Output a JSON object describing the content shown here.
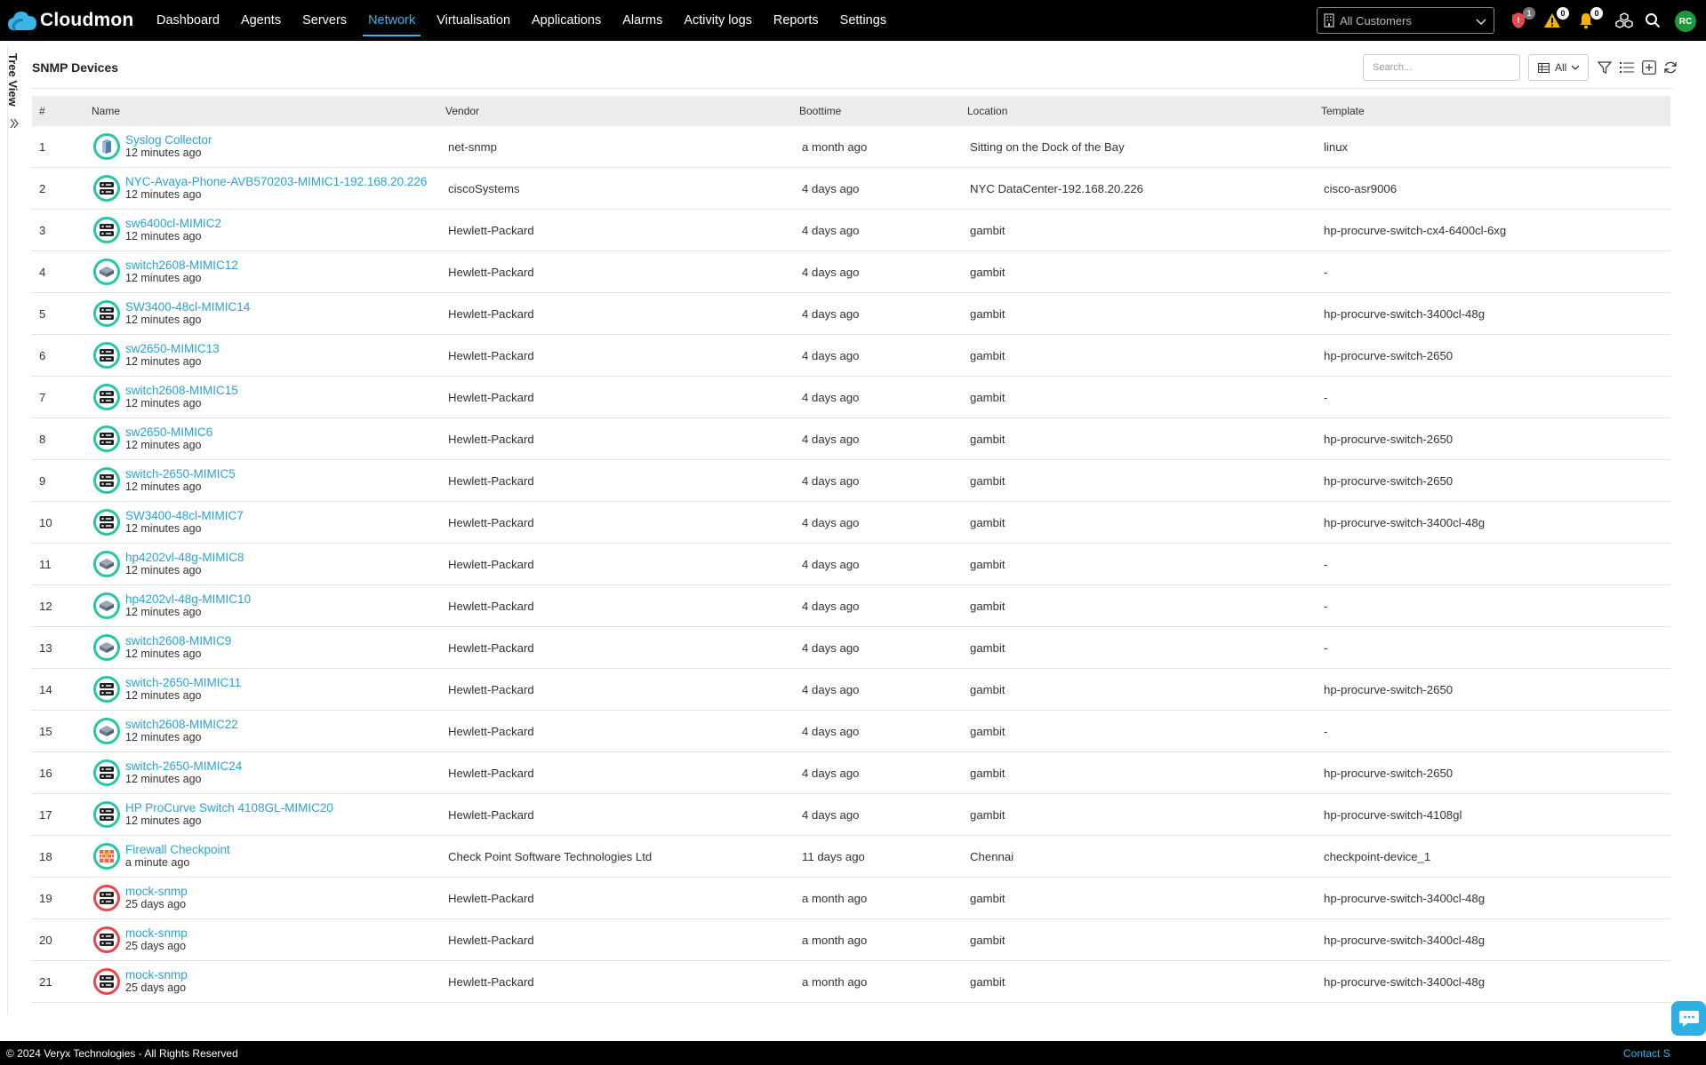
{
  "header": {
    "logo_text": "Cloudmon",
    "nav": [
      "Dashboard",
      "Agents",
      "Servers",
      "Network",
      "Virtualisation",
      "Applications",
      "Alarms",
      "Activity logs",
      "Reports",
      "Settings"
    ],
    "active_nav": "Network",
    "customer_select": "All Customers",
    "security_badge": "1",
    "warning_badge": "0",
    "bell_badge": "0",
    "user_initials": "RC"
  },
  "sidebar": {
    "tree_view_label": "Tree View"
  },
  "panel": {
    "title": "SNMP Devices",
    "search_placeholder": "Search...",
    "view_filter": "All"
  },
  "table": {
    "columns": [
      "#",
      "Name",
      "Vendor",
      "Boottime",
      "Location",
      "Template"
    ],
    "rows": [
      {
        "num": "1",
        "name": "Syslog Collector",
        "seen": "12 minutes ago",
        "vendor": "net-snmp",
        "boottime": "a month ago",
        "location": "Sitting on the Dock of the Bay",
        "template": "linux",
        "icon": "server-icon",
        "status": "up"
      },
      {
        "num": "2",
        "name": "NYC-Avaya-Phone-AVB570203-MIMIC1-192.168.20.226",
        "seen": "12 minutes ago",
        "vendor": "ciscoSystems",
        "boottime": "4 days ago",
        "location": "NYC DataCenter-192.168.20.226",
        "template": "cisco-asr9006",
        "icon": "router-icon",
        "status": "up"
      },
      {
        "num": "3",
        "name": "sw6400cl-MIMIC2",
        "seen": "12 minutes ago",
        "vendor": "Hewlett-Packard",
        "boottime": "4 days ago",
        "location": "gambit",
        "template": "hp-procurve-switch-cx4-6400cl-6xg",
        "icon": "router-icon",
        "status": "up"
      },
      {
        "num": "4",
        "name": "switch2608-MIMIC12",
        "seen": "12 minutes ago",
        "vendor": "Hewlett-Packard",
        "boottime": "4 days ago",
        "location": "gambit",
        "template": "-",
        "icon": "switch-icon",
        "status": "up"
      },
      {
        "num": "5",
        "name": "SW3400-48cl-MIMIC14",
        "seen": "12 minutes ago",
        "vendor": "Hewlett-Packard",
        "boottime": "4 days ago",
        "location": "gambit",
        "template": "hp-procurve-switch-3400cl-48g",
        "icon": "router-icon",
        "status": "up"
      },
      {
        "num": "6",
        "name": "sw2650-MIMIC13",
        "seen": "12 minutes ago",
        "vendor": "Hewlett-Packard",
        "boottime": "4 days ago",
        "location": "gambit",
        "template": "hp-procurve-switch-2650",
        "icon": "router-icon",
        "status": "up"
      },
      {
        "num": "7",
        "name": "switch2608-MIMIC15",
        "seen": "12 minutes ago",
        "vendor": "Hewlett-Packard",
        "boottime": "4 days ago",
        "location": "gambit",
        "template": "-",
        "icon": "router-icon",
        "status": "up"
      },
      {
        "num": "8",
        "name": "sw2650-MIMIC6",
        "seen": "12 minutes ago",
        "vendor": "Hewlett-Packard",
        "boottime": "4 days ago",
        "location": "gambit",
        "template": "hp-procurve-switch-2650",
        "icon": "router-icon",
        "status": "up"
      },
      {
        "num": "9",
        "name": "switch-2650-MIMIC5",
        "seen": "12 minutes ago",
        "vendor": "Hewlett-Packard",
        "boottime": "4 days ago",
        "location": "gambit",
        "template": "hp-procurve-switch-2650",
        "icon": "router-icon",
        "status": "up"
      },
      {
        "num": "10",
        "name": "SW3400-48cl-MIMIC7",
        "seen": "12 minutes ago",
        "vendor": "Hewlett-Packard",
        "boottime": "4 days ago",
        "location": "gambit",
        "template": "hp-procurve-switch-3400cl-48g",
        "icon": "router-icon",
        "status": "up"
      },
      {
        "num": "11",
        "name": "hp4202vl-48g-MIMIC8",
        "seen": "12 minutes ago",
        "vendor": "Hewlett-Packard",
        "boottime": "4 days ago",
        "location": "gambit",
        "template": "-",
        "icon": "switch-icon",
        "status": "up"
      },
      {
        "num": "12",
        "name": "hp4202vl-48g-MIMIC10",
        "seen": "12 minutes ago",
        "vendor": "Hewlett-Packard",
        "boottime": "4 days ago",
        "location": "gambit",
        "template": "-",
        "icon": "switch-icon",
        "status": "up"
      },
      {
        "num": "13",
        "name": "switch2608-MIMIC9",
        "seen": "12 minutes ago",
        "vendor": "Hewlett-Packard",
        "boottime": "4 days ago",
        "location": "gambit",
        "template": "-",
        "icon": "switch-icon",
        "status": "up"
      },
      {
        "num": "14",
        "name": "switch-2650-MIMIC11",
        "seen": "12 minutes ago",
        "vendor": "Hewlett-Packard",
        "boottime": "4 days ago",
        "location": "gambit",
        "template": "hp-procurve-switch-2650",
        "icon": "router-icon",
        "status": "up"
      },
      {
        "num": "15",
        "name": "switch2608-MIMIC22",
        "seen": "12 minutes ago",
        "vendor": "Hewlett-Packard",
        "boottime": "4 days ago",
        "location": "gambit",
        "template": "-",
        "icon": "switch-icon",
        "status": "up"
      },
      {
        "num": "16",
        "name": "switch-2650-MIMIC24",
        "seen": "12 minutes ago",
        "vendor": "Hewlett-Packard",
        "boottime": "4 days ago",
        "location": "gambit",
        "template": "hp-procurve-switch-2650",
        "icon": "router-icon",
        "status": "up"
      },
      {
        "num": "17",
        "name": "HP ProCurve Switch 4108GL-MIMIC20",
        "seen": "12 minutes ago",
        "vendor": "Hewlett-Packard",
        "boottime": "4 days ago",
        "location": "gambit",
        "template": "hp-procurve-switch-4108gl",
        "icon": "router-icon",
        "status": "up"
      },
      {
        "num": "18",
        "name": "Firewall Checkpoint",
        "seen": "a minute ago",
        "vendor": "Check Point Software Technologies Ltd",
        "boottime": "11 days ago",
        "location": "Chennai",
        "template": "checkpoint-device_1",
        "icon": "firewall-icon",
        "status": "up"
      },
      {
        "num": "19",
        "name": "mock-snmp",
        "seen": "25 days ago",
        "vendor": "Hewlett-Packard",
        "boottime": "a month ago",
        "location": "gambit",
        "template": "hp-procurve-switch-3400cl-48g",
        "icon": "router-icon",
        "status": "down"
      },
      {
        "num": "20",
        "name": "mock-snmp",
        "seen": "25 days ago",
        "vendor": "Hewlett-Packard",
        "boottime": "a month ago",
        "location": "gambit",
        "template": "hp-procurve-switch-3400cl-48g",
        "icon": "router-icon",
        "status": "down"
      },
      {
        "num": "21",
        "name": "mock-snmp",
        "seen": "25 days ago",
        "vendor": "Hewlett-Packard",
        "boottime": "a month ago",
        "location": "gambit",
        "template": "hp-procurve-switch-3400cl-48g",
        "icon": "router-icon",
        "status": "down"
      }
    ]
  },
  "footer": {
    "copyright": "© 2024 Veryx Technologies - All Rights Reserved",
    "contact": "Contact S"
  },
  "colors": {
    "accent": "#3ab5e8",
    "link": "#29a3d6",
    "status_up": "#27c7a2",
    "status_down": "#e8484c"
  }
}
